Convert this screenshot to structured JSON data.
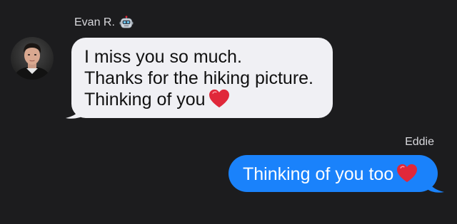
{
  "incoming": {
    "sender_name": "Evan R.",
    "sender_badge_icon": "robot-icon",
    "avatar_icon": "person-avatar",
    "lines": [
      "I miss you so much.",
      "Thanks for the hiking picture.",
      "Thinking of you"
    ],
    "trailing_icon": "red-heart-icon",
    "bubble_color": "#f0f0f4"
  },
  "outgoing": {
    "receiver_name": "Eddie",
    "text": "Thinking of you too",
    "trailing_icon": "red-heart-icon",
    "bubble_color": "#1a82fb"
  },
  "colors": {
    "background": "#1c1c1e",
    "heart": "#e0283a"
  }
}
